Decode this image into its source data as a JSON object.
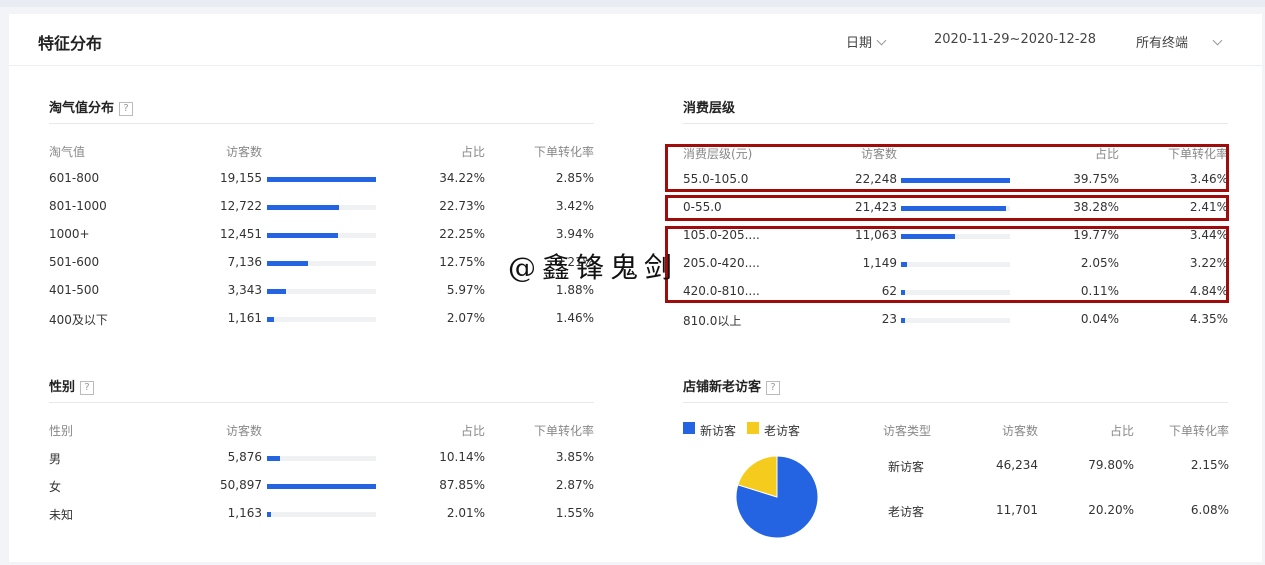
{
  "header": {
    "title": "特征分布",
    "date_label": "日期",
    "date_range": "2020-11-29~2020-12-28",
    "terminal": "所有终端"
  },
  "taoqi": {
    "title": "淘气值分布",
    "cols": [
      "淘气值",
      "访客数",
      "占比",
      "下单转化率"
    ],
    "rows": [
      {
        "label": "601-800",
        "visitors": "19,155",
        "bar": 1.0,
        "share": "34.22%",
        "conv": "2.85%"
      },
      {
        "label": "801-1000",
        "visitors": "12,722",
        "bar": 0.664,
        "share": "22.73%",
        "conv": "3.42%"
      },
      {
        "label": "1000+",
        "visitors": "12,451",
        "bar": 0.65,
        "share": "22.25%",
        "conv": "3.94%"
      },
      {
        "label": "501-600",
        "visitors": "7,136",
        "bar": 0.373,
        "share": "12.75%",
        "conv": "2.21%"
      },
      {
        "label": "401-500",
        "visitors": "3,343",
        "bar": 0.175,
        "share": "5.97%",
        "conv": "1.88%"
      },
      {
        "label": "400及以下",
        "visitors": "1,161",
        "bar": 0.061,
        "share": "2.07%",
        "conv": "1.46%"
      }
    ]
  },
  "consume": {
    "title": "消费层级",
    "cols": [
      "消费层级(元)",
      "访客数",
      "占比",
      "下单转化率"
    ],
    "rows": [
      {
        "label": "55.0-105.0",
        "visitors": "22,248",
        "bar": 1.0,
        "share": "39.75%",
        "conv": "3.46%"
      },
      {
        "label": "0-55.0",
        "visitors": "21,423",
        "bar": 0.963,
        "share": "38.28%",
        "conv": "2.41%"
      },
      {
        "label": "105.0-205....",
        "visitors": "11,063",
        "bar": 0.497,
        "share": "19.77%",
        "conv": "3.44%"
      },
      {
        "label": "205.0-420....",
        "visitors": "1,149",
        "bar": 0.052,
        "share": "2.05%",
        "conv": "3.22%"
      },
      {
        "label": "420.0-810....",
        "visitors": "62",
        "bar": 0.003,
        "share": "0.11%",
        "conv": "4.84%"
      },
      {
        "label": "810.0以上",
        "visitors": "23",
        "bar": 0.001,
        "share": "0.04%",
        "conv": "4.35%"
      }
    ]
  },
  "gender": {
    "title": "性别",
    "cols": [
      "性别",
      "访客数",
      "占比",
      "下单转化率"
    ],
    "rows": [
      {
        "label": "男",
        "visitors": "5,876",
        "bar": 0.115,
        "share": "10.14%",
        "conv": "3.85%"
      },
      {
        "label": "女",
        "visitors": "50,897",
        "bar": 1.0,
        "share": "87.85%",
        "conv": "2.87%"
      },
      {
        "label": "未知",
        "visitors": "1,163",
        "bar": 0.023,
        "share": "2.01%",
        "conv": "1.55%"
      }
    ]
  },
  "newold": {
    "title": "店铺新老访客",
    "legend": [
      {
        "name": "新访客",
        "color": "#2464e2"
      },
      {
        "name": "老访客",
        "color": "#f5cb1d"
      }
    ],
    "cols": [
      "访客类型",
      "访客数",
      "占比",
      "下单转化率"
    ],
    "rows": [
      {
        "label": "新访客",
        "visitors": "46,234",
        "share": "79.80%",
        "conv": "2.15%"
      },
      {
        "label": "老访客",
        "visitors": "11,701",
        "share": "20.20%",
        "conv": "6.08%"
      }
    ]
  },
  "chart_data": {
    "type": "pie",
    "categories": [
      "新访客",
      "老访客"
    ],
    "values": [
      79.8,
      20.2
    ],
    "colors": [
      "#2464e2",
      "#f5cb1d"
    ]
  },
  "watermark": "@鑫锋鬼剑"
}
